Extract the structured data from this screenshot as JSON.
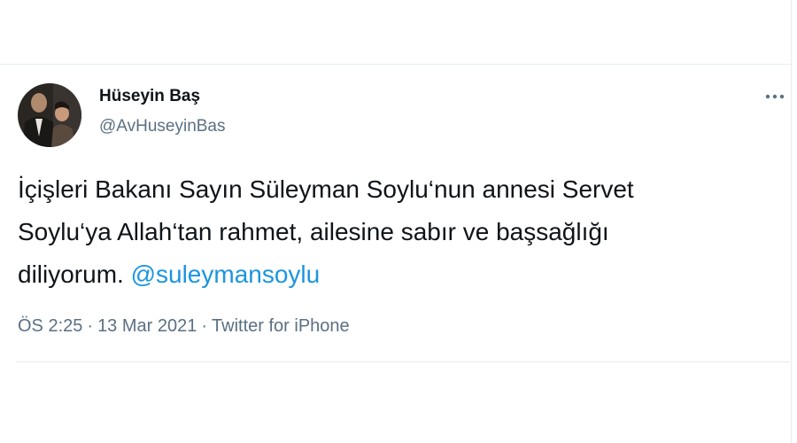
{
  "author": {
    "display_name": "Hüseyin Baş",
    "handle": "@AvHuseyinBas"
  },
  "tweet": {
    "line1": "İçişleri Bakanı Sayın Süleyman Soylu‘nun annesi Servet",
    "line2": "Soylu‘ya Allah‘tan rahmet, ailesine sabır ve başsağlığı",
    "line3_text": "diliyorum. ",
    "mention": "@suleymansoylu"
  },
  "meta": {
    "time": "ÖS 2:25",
    "separator": "·",
    "date": "13 Mar 2021",
    "source": "Twitter for iPhone"
  },
  "icons": {
    "more": "more-horizontal-icon"
  },
  "colors": {
    "text": "#0f1419",
    "secondary": "#5b7083",
    "link": "#1b95e0",
    "divider": "#e6ecf0"
  }
}
